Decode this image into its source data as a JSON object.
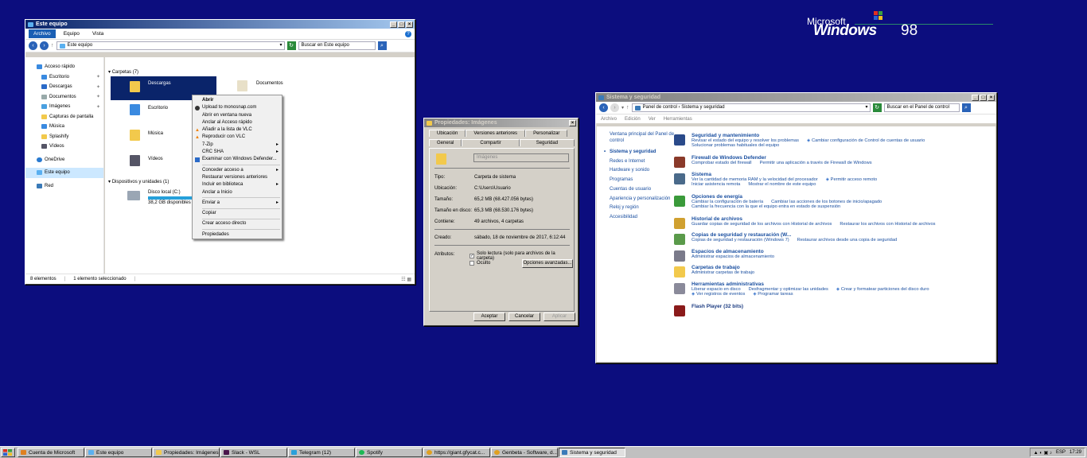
{
  "desktop": {
    "logo_top": "Microsoft",
    "logo_win": "Windows",
    "logo_ver": "98"
  },
  "explorer": {
    "title": "Este equipo",
    "tabs": [
      "Archivo",
      "Equipo",
      "Vista"
    ],
    "address": "Este equipo",
    "search_placeholder": "Buscar en Este equipo",
    "nav": [
      "Acceso rápido",
      "Escritorio",
      "Descargas",
      "Documentos",
      "Imágenes",
      "Capturas de pantalla",
      "Música",
      "Splashify",
      "Vídeos",
      "OneDrive",
      "Este equipo",
      "Red"
    ],
    "group_folders": "Carpetas (7)",
    "folders": [
      "Descargas",
      "Documentos",
      "Escritorio",
      "Música",
      "Vídeos"
    ],
    "group_devices": "Dispositivos y unidades (1)",
    "disk_name": "Disco local (C:)",
    "disk_free": "38,2 GB disponibles de",
    "status_count": "8 elementos",
    "status_sel": "1 elemento seleccionado"
  },
  "context_menu": {
    "items": [
      "Abrir",
      "Upload to monosnap.com",
      "Abrir en ventana nueva",
      "Anclar al Acceso rápido",
      "Añadir a la lista de VLC",
      "Reproducir con VLC",
      "7-Zip",
      "CRC SHA",
      "Examinar con Windows Defender...",
      "Conceder acceso a",
      "Restaurar versiones anteriores",
      "Incluir en biblioteca",
      "Anclar a Inicio",
      "Enviar a",
      "Copiar",
      "Crear acceso directo",
      "Propiedades"
    ]
  },
  "properties": {
    "title": "Propiedades: Imágenes",
    "tabs_top": [
      "Ubicación",
      "Versiones anteriores",
      "Personalizar"
    ],
    "tabs_bottom": [
      "General",
      "Compartir",
      "Seguridad"
    ],
    "name": "Imágenes",
    "rows": [
      {
        "k": "Tipo:",
        "v": "Carpeta de sistema"
      },
      {
        "k": "Ubicación:",
        "v": "C:\\Users\\Usuario"
      },
      {
        "k": "Tamaño:",
        "v": "65,2 MB (68.427.056 bytes)"
      },
      {
        "k": "Tamaño en disco:",
        "v": "65,3 MB (68.530.176 bytes)"
      },
      {
        "k": "Contiene:",
        "v": "49 archivos, 4 carpetas"
      },
      {
        "k": "Creado:",
        "v": "sábado, 18 de noviembre de 2017, 6:12:44"
      }
    ],
    "attrs_label": "Atributos:",
    "readonly": "Solo lectura (solo para archivos de la carpeta)",
    "hidden": "Oculto",
    "advanced": "Opciones avanzadas...",
    "ok": "Aceptar",
    "cancel": "Cancelar",
    "apply": "Aplicar"
  },
  "control_panel": {
    "title": "Sistema y seguridad",
    "address": "Panel de control  ›  Sistema y seguridad",
    "search_placeholder": "Buscar en el Panel de control",
    "menu": [
      "Archivo",
      "Edición",
      "Ver",
      "Herramientas"
    ],
    "side": [
      "Ventana principal del Panel de control",
      "Sistema y seguridad",
      "Redes e Internet",
      "Hardware y sonido",
      "Programas",
      "Cuentas de usuario",
      "Apariencia y personalización",
      "Reloj y región",
      "Accesibilidad"
    ],
    "cats": [
      {
        "t": "Seguridad y mantenimiento",
        "l1": [
          "Revisar el estado del equipo y resolver los problemas",
          "Cambiar configuración de Control de cuentas de usuario"
        ],
        "l2": [
          "Solucionar problemas habituales del equipo"
        ]
      },
      {
        "t": "Firewall de Windows Defender",
        "l1": [
          "Comprobar estado del firewall",
          "Permitir una aplicación a través de Firewall de Windows"
        ],
        "l2": []
      },
      {
        "t": "Sistema",
        "l1": [
          "Ver la cantidad de memoria RAM y la velocidad del procesador",
          "Permitir acceso remoto"
        ],
        "l2": [
          "Iniciar asistencia remota",
          "Mostrar el nombre de este equipo"
        ]
      },
      {
        "t": "Opciones de energía",
        "l1": [
          "Cambiar la configuración de batería",
          "Cambiar las acciones de los botones de inicio/apagado"
        ],
        "l2": [
          "Cambiar la frecuencia con la que el equipo entra en estado de suspensión"
        ]
      },
      {
        "t": "Historial de archivos",
        "l1": [
          "Guardar copias de seguridad de los archivos con Historial de archivos",
          "Restaurar los archivos con Historial de archivos"
        ],
        "l2": []
      },
      {
        "t": "Copias de seguridad y restauración (W...",
        "l1": [
          "Copias de seguridad y restauración (Windows 7)",
          "Restaurar archivos desde una copia de seguridad"
        ],
        "l2": []
      },
      {
        "t": "Espacios de almacenamiento",
        "l1": [
          "Administrar espacios de almacenamiento"
        ],
        "l2": []
      },
      {
        "t": "Carpetas de trabajo",
        "l1": [
          "Administrar carpetas de trabajo"
        ],
        "l2": []
      },
      {
        "t": "Herramientas administrativas",
        "l1": [
          "Liberar espacio en disco",
          "Desfragmentar y optimizar las unidades",
          "Crear y formatear particiones del disco duro"
        ],
        "l2": [
          "Ver registros de eventos",
          "Programar tareas"
        ]
      },
      {
        "t": "Flash Player (32 bits)",
        "l1": [],
        "l2": []
      }
    ]
  },
  "taskbar": {
    "items": [
      "Cuenta de Microsoft",
      "Este equipo",
      "Propiedades: Imágenes",
      "Slack - WSL",
      "Telegram (12)",
      "Spotify",
      "https://giant.gfycat.c...",
      "Genbeta - Software, d...",
      "Sistema y seguridad"
    ],
    "lang": "ESP",
    "time": "17:29"
  }
}
